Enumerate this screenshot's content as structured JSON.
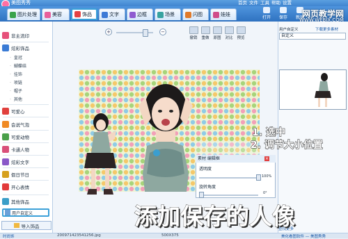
{
  "app": {
    "title": "美图秀秀"
  },
  "top_menu": [
    "首页",
    "文件",
    "工具",
    "帮助",
    "设置"
  ],
  "watermark": {
    "text": "网页教学网",
    "url": "WWW.WEBJX.COM"
  },
  "tabs": [
    {
      "label": "图片处理",
      "color": "#3aa34a"
    },
    {
      "label": "美容",
      "color": "#e8609b"
    },
    {
      "label": "饰品",
      "color": "#e34242"
    },
    {
      "label": "文字",
      "color": "#3d7ad6"
    },
    {
      "label": "边框",
      "color": "#8f5bd0"
    },
    {
      "label": "场景",
      "color": "#38a3a0"
    },
    {
      "label": "闪图",
      "color": "#e07a2a"
    },
    {
      "label": "娃娃",
      "color": "#d04c8a"
    }
  ],
  "toolbar_right": [
    "打开",
    "保存",
    "新建"
  ],
  "sidebar": {
    "items": [
      {
        "label": "非主流印",
        "color": "#e6507a"
      },
      {
        "label": "炫彩饰品",
        "color": "#3a7bd5"
      },
      {
        "label": "可爱心",
        "color": "#e0403d"
      },
      {
        "label": "会说气泡",
        "color": "#f08a24"
      },
      {
        "label": "可爱动物",
        "color": "#4aa04a"
      },
      {
        "label": "卡通人物",
        "color": "#d9507a"
      },
      {
        "label": "炫彩文字",
        "color": "#8a58c8"
      },
      {
        "label": "假日节日",
        "color": "#d6a01e"
      },
      {
        "label": "开心表情",
        "color": "#e23a3a"
      },
      {
        "label": "其他饰品",
        "color": "#3a9ec8"
      }
    ],
    "sub_items": [
      "皇冠",
      "蝴蝶结",
      "挂饰",
      "项链",
      "帽子",
      "其他"
    ],
    "custom_label": "用户自定义",
    "import_label": "导入饰品"
  },
  "edit_buttons": [
    "撤销",
    "重做",
    "原图",
    "对比",
    "预览"
  ],
  "sticker_panel": {
    "title": "素材 编辑框",
    "opacity_label": "透明度",
    "opacity_value": "100%",
    "rotate_label": "旋转角度",
    "rotate_value": "0°"
  },
  "right_panel": {
    "tab_label": "用户自定义",
    "link_label": "下载更多素材",
    "select_value": "自定义",
    "footer_link": "查找更多"
  },
  "status": {
    "filename": "200971423541256.jpg",
    "size": "500X375",
    "left_label": "时尚饰",
    "right_label": "美化看图软件 — 美图秀秀"
  },
  "annotations": {
    "caption": "添加保存的人像",
    "step1": "1. 选中",
    "step2": "2. 调节大小位置"
  }
}
